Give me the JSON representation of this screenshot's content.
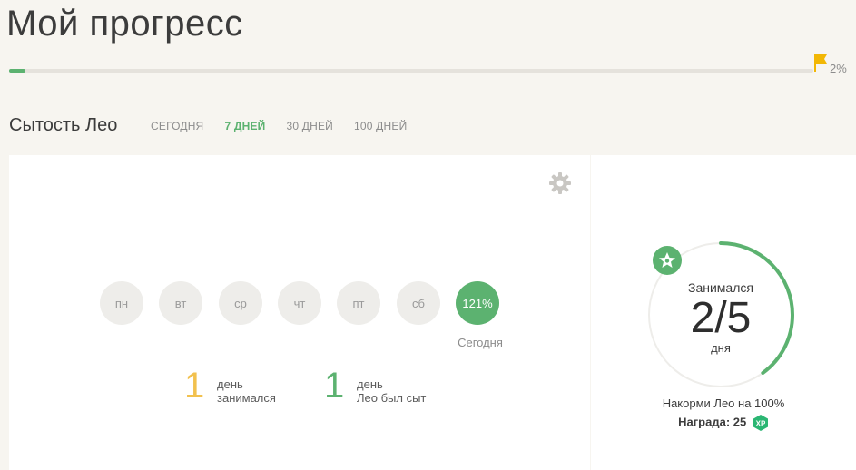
{
  "header": {
    "title": "Мой прогресс",
    "progress_percent": 2,
    "progress_label": "2%"
  },
  "section": {
    "title": "Сытость Лео",
    "tabs": [
      {
        "label": "СЕГОДНЯ",
        "active": false
      },
      {
        "label": "7 ДНЕЙ",
        "active": true
      },
      {
        "label": "30 ДНЕЙ",
        "active": false
      },
      {
        "label": "100 ДНЕЙ",
        "active": false
      }
    ]
  },
  "week": {
    "days": [
      {
        "label": "пн"
      },
      {
        "label": "вт"
      },
      {
        "label": "ср"
      },
      {
        "label": "чт"
      },
      {
        "label": "пт"
      },
      {
        "label": "сб"
      },
      {
        "label": "121%",
        "today": true
      }
    ],
    "today_label": "Сегодня"
  },
  "stats": [
    {
      "value": "1",
      "line1": "день",
      "line2": "занимался",
      "color": "#f2c14e"
    },
    {
      "value": "1",
      "line1": "день",
      "line2": "Лео был сыт",
      "color": "#5cb270"
    }
  ],
  "goal": {
    "caption_top": "Занимался",
    "value": "2/5",
    "caption_bottom": "дня",
    "done": 2,
    "total": 5,
    "text": "Накорми Лео на 100%",
    "reward": "Награда: 25",
    "xp_label": "XP"
  },
  "colors": {
    "accent": "#5cb270",
    "flag": "#f2b705",
    "stat_yellow": "#f2c14e"
  }
}
